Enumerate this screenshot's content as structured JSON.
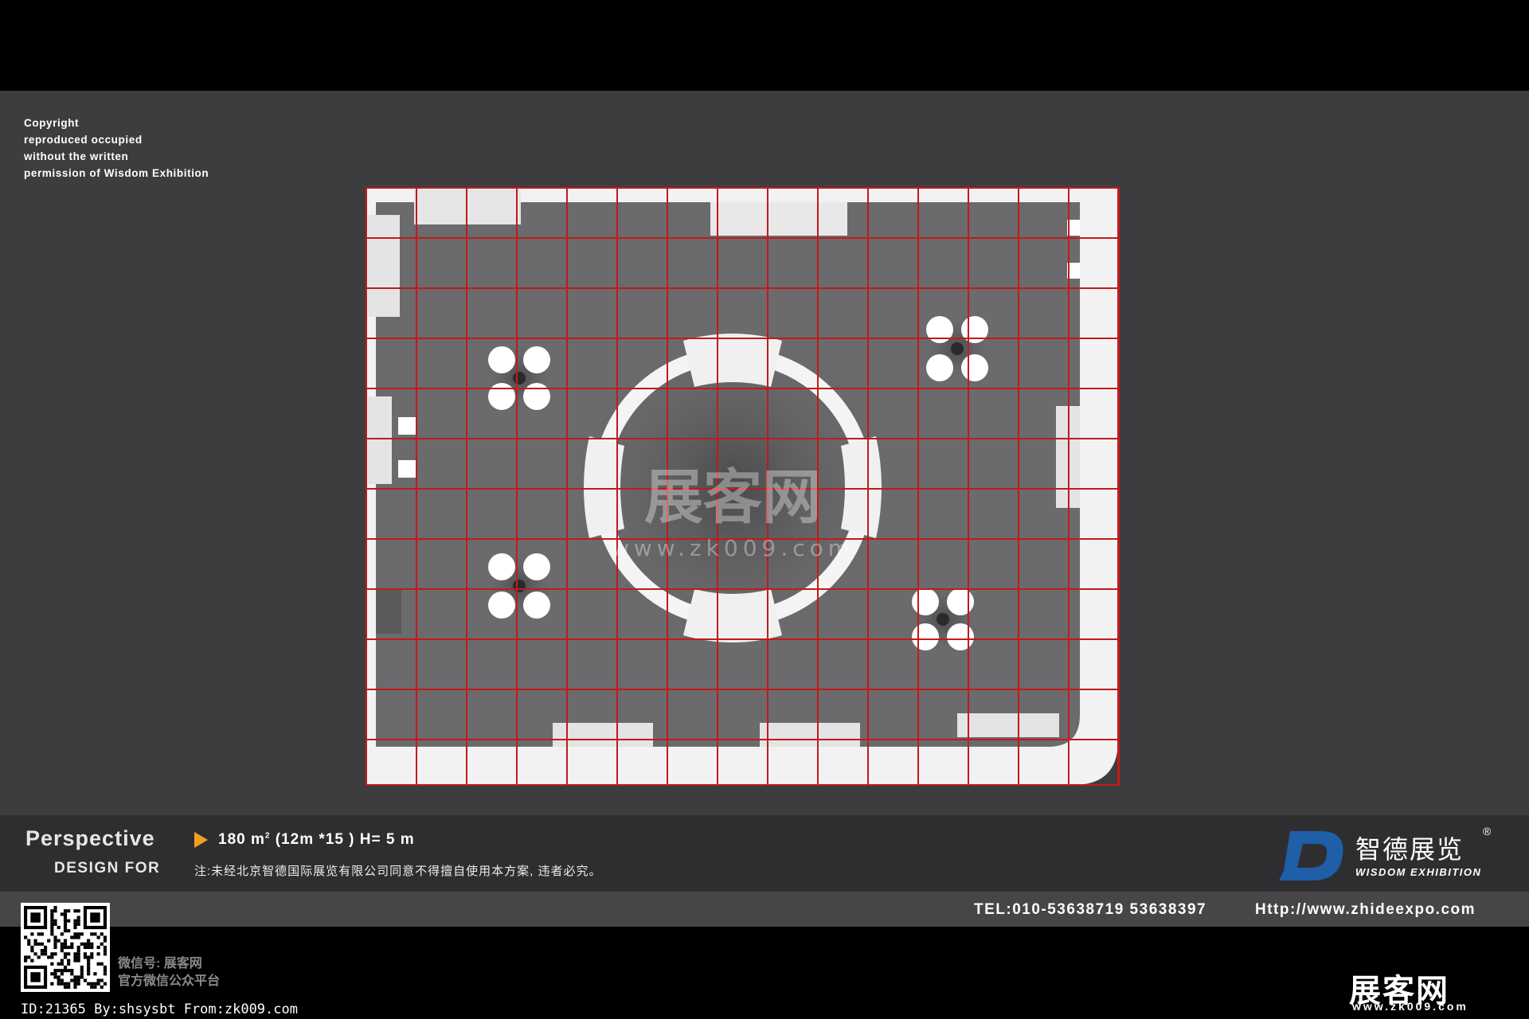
{
  "copyright": {
    "lines": [
      "Copyright",
      "reproduced occupied",
      "without the written",
      "permission of Wisdom Exhibition"
    ]
  },
  "watermark": {
    "cn": "展客网",
    "url": "www.zk009.com"
  },
  "info": {
    "title": "Perspective",
    "subtitle": "DESIGN FOR",
    "area": "180",
    "area_unit": "m",
    "area_unit_sup": "2",
    "size": "(12m  *15 ) H= 5  m",
    "notice": "注:未经北京智德国际展览有限公司同意不得擅自使用本方案, 违者必究。"
  },
  "brand": {
    "logo_letter": "D",
    "name_cn": "智德展览",
    "registered": "®",
    "name_en": "WISDOM EXHIBITION",
    "accent_color": "#1f5fa8"
  },
  "contact": {
    "tel": "TEL:010-53638719   53638397",
    "url": "Http://www.zhideexpo.com"
  },
  "footer": {
    "wechat_line1": "微信号: 展客网",
    "wechat_line2": "官方微信公众平台",
    "id_line": "ID:21365 By:shsysbt From:zk009.com",
    "logo_cn": "展客网",
    "logo_url": "www.zk009.com"
  },
  "colors": {
    "canvas": "#3d3d3f",
    "floor": "#6b6b6d",
    "walls": "#f2f2f2",
    "grid": "#c21a1a",
    "arrow": "#f0a022"
  }
}
